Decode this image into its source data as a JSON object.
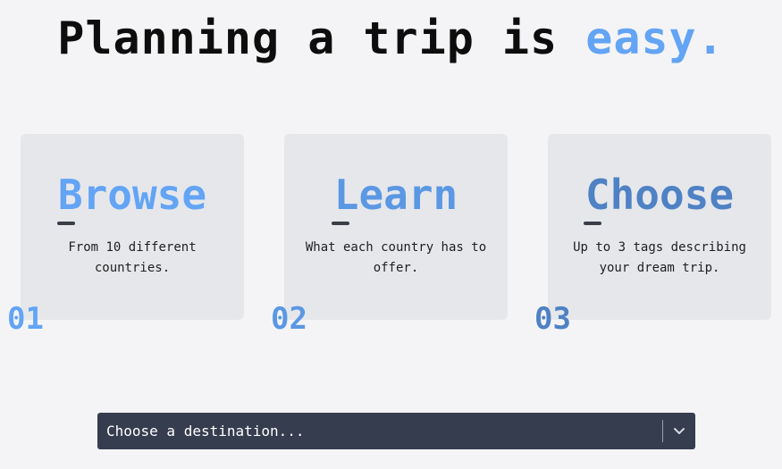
{
  "hero": {
    "title_main": "Planning a trip is ",
    "title_accent": "easy."
  },
  "cards": [
    {
      "title": "Browse",
      "description": "From 10 different countries.",
      "number": "01",
      "title_color": "#63a4f5",
      "number_color": "#63a4f5"
    },
    {
      "title": "Learn",
      "description": "What each country has to offer.",
      "number": "02",
      "title_color": "#5b98e3",
      "number_color": "#5b98e3"
    },
    {
      "title": "Choose",
      "description": "Up to 3 tags describing your dream trip.",
      "number": "03",
      "title_color": "#4f82c4",
      "number_color": "#4f82c4"
    }
  ],
  "destination_select": {
    "placeholder": "Choose a destination...",
    "icon": "chevron-down-icon"
  },
  "colors": {
    "background": "#f4f4f6",
    "card": "#e6e7eb",
    "accent": "#63a4f5",
    "select_bg": "#363d4f"
  }
}
